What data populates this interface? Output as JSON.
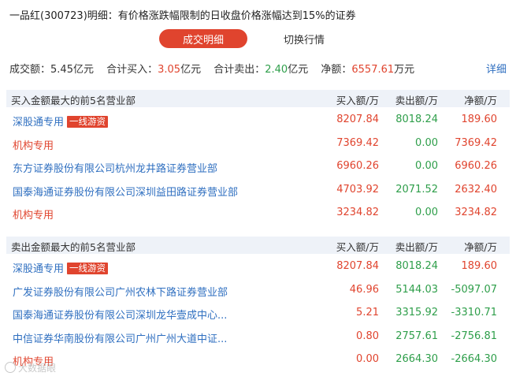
{
  "title": "一品红(300723)明细：有价格涨跌幅限制的日收盘价格涨幅达到15%的证券",
  "tabs": {
    "active": "成交明细",
    "inactive": "切换行情"
  },
  "summary": {
    "turnover_label": "成交额：",
    "turnover_value": "5.45亿元",
    "buy_label": "合计买入：",
    "buy_value": "3.05",
    "buy_unit": "亿元",
    "sell_label": "合计卖出：",
    "sell_value": "2.40",
    "sell_unit": "亿元",
    "net_label": "净额：",
    "net_value": "6557.61",
    "net_unit": "万元",
    "detail_link": "详细"
  },
  "columns": {
    "buy": "买入额/万",
    "sell": "卖出额/万",
    "net": "净额/万"
  },
  "buy_section": {
    "title": "买入金额最大的前5名营业部",
    "rows": [
      {
        "name": "深股通专用",
        "tag": "一线游资",
        "buy": "8207.84",
        "sell": "8018.24",
        "net": "189.60"
      },
      {
        "name": "机构专用",
        "tag": "",
        "buy": "7369.42",
        "sell": "0.00",
        "net": "7369.42"
      },
      {
        "name": "东方证券股份有限公司杭州龙井路证券营业部",
        "tag": "",
        "buy": "6960.26",
        "sell": "0.00",
        "net": "6960.26"
      },
      {
        "name": "国泰海通证券股份有限公司深圳益田路证券营业部",
        "tag": "",
        "buy": "4703.92",
        "sell": "2071.52",
        "net": "2632.40"
      },
      {
        "name": "机构专用",
        "tag": "",
        "buy": "3234.82",
        "sell": "0.00",
        "net": "3234.82"
      }
    ]
  },
  "sell_section": {
    "title": "卖出金额最大的前5名营业部",
    "rows": [
      {
        "name": "深股通专用",
        "tag": "一线游资",
        "buy": "8207.84",
        "sell": "8018.24",
        "net": "189.60"
      },
      {
        "name": "广发证券股份有限公司广州农林下路证券营业部",
        "tag": "",
        "buy": "46.96",
        "sell": "5144.03",
        "net": "-5097.07"
      },
      {
        "name": "国泰海通证券股份有限公司深圳龙华壹成中心...",
        "tag": "",
        "buy": "5.21",
        "sell": "3315.92",
        "net": "-3310.71"
      },
      {
        "name": "中信证券华南股份有限公司广州广州大道中证...",
        "tag": "",
        "buy": "0.80",
        "sell": "2757.61",
        "net": "-2756.81"
      },
      {
        "name": "机构专用",
        "tag": "",
        "buy": "0.00",
        "sell": "2664.30",
        "net": "-2664.30"
      }
    ]
  },
  "watermark": "大数据眼",
  "colors": {
    "red": "#e0442e",
    "green": "#2e9e4a",
    "blue": "#2f6fc0",
    "header_bg": "#eef2f8"
  }
}
